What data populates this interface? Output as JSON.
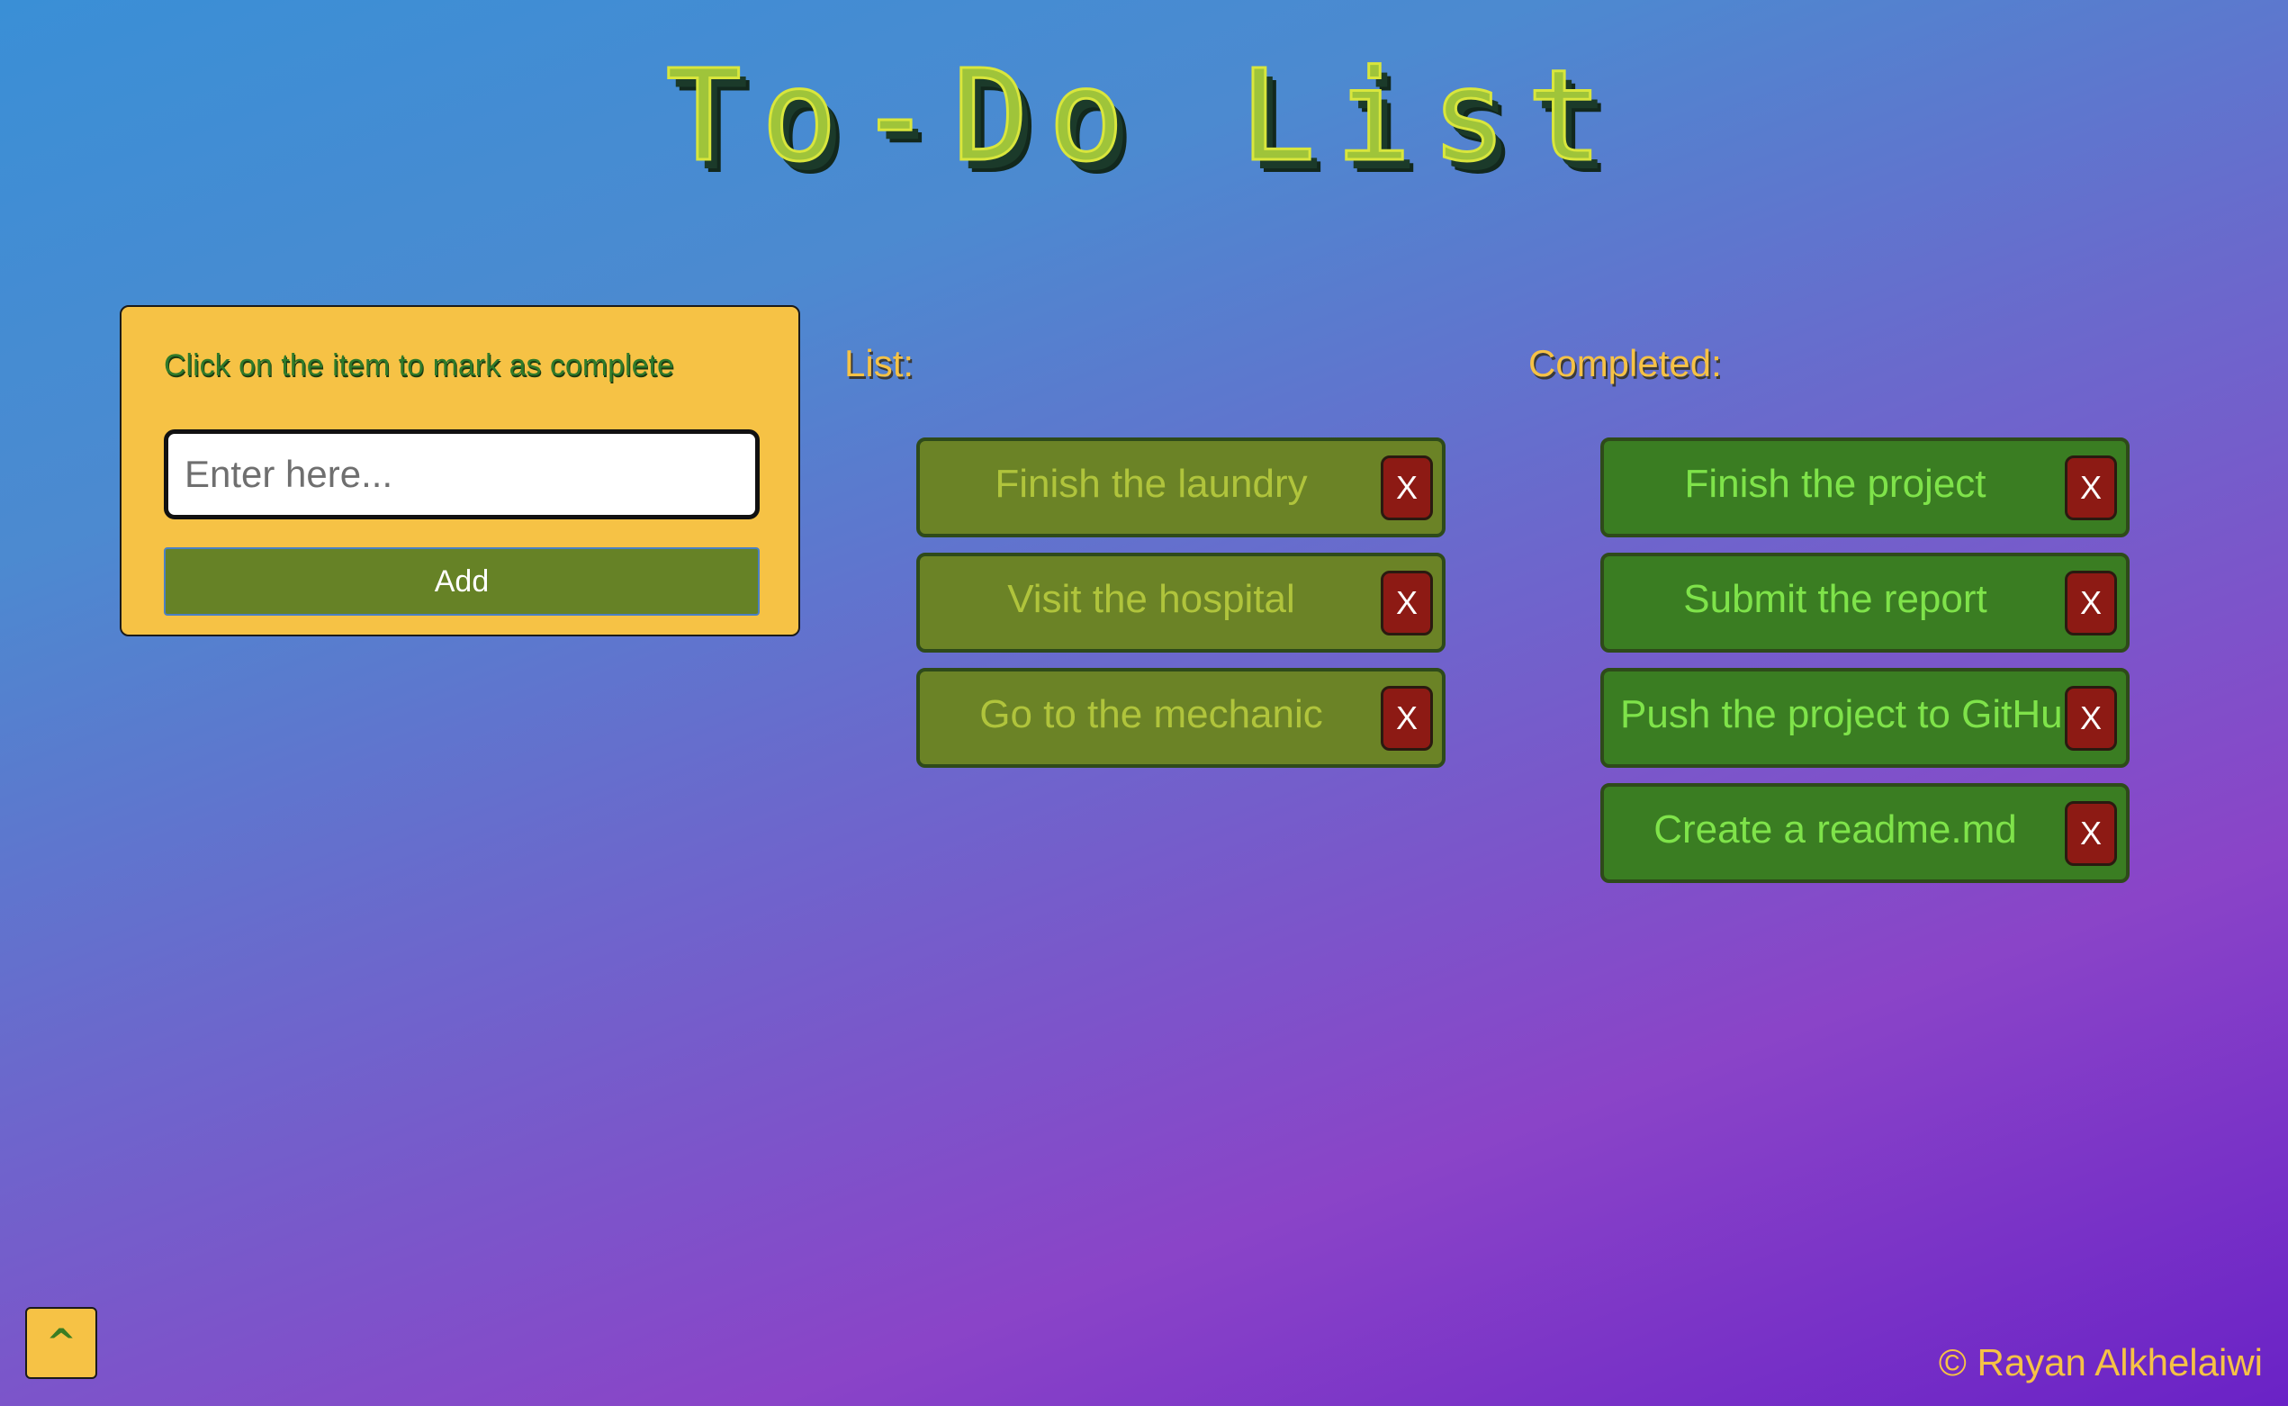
{
  "header": {
    "title": "To-Do List"
  },
  "input_panel": {
    "hint": "Click on the item to mark as complete",
    "input_placeholder": "Enter here...",
    "input_value": "",
    "add_label": "Add"
  },
  "list": {
    "heading": "List:",
    "items": [
      {
        "text": "Finish the laundry",
        "delete_label": "X"
      },
      {
        "text": "Visit the hospital",
        "delete_label": "X"
      },
      {
        "text": "Go to the mechanic",
        "delete_label": "X"
      }
    ]
  },
  "completed": {
    "heading": "Completed:",
    "items": [
      {
        "text": "Finish the project",
        "delete_label": "X"
      },
      {
        "text": "Submit the report",
        "delete_label": "X"
      },
      {
        "text": "Push the project to GitHub",
        "delete_label": "X"
      },
      {
        "text": "Create a readme.md",
        "delete_label": "X"
      }
    ]
  },
  "scroll_top": {
    "label": "^",
    "icon": "chevron-up-icon"
  },
  "footer": {
    "credit": "© Rayan Alkhelaiwi"
  },
  "colors": {
    "panel": "#f6c245",
    "pending_item": "#6b8326",
    "completed_item": "#3a7d22",
    "delete_button": "#8d1a14",
    "add_button": "#668226"
  }
}
